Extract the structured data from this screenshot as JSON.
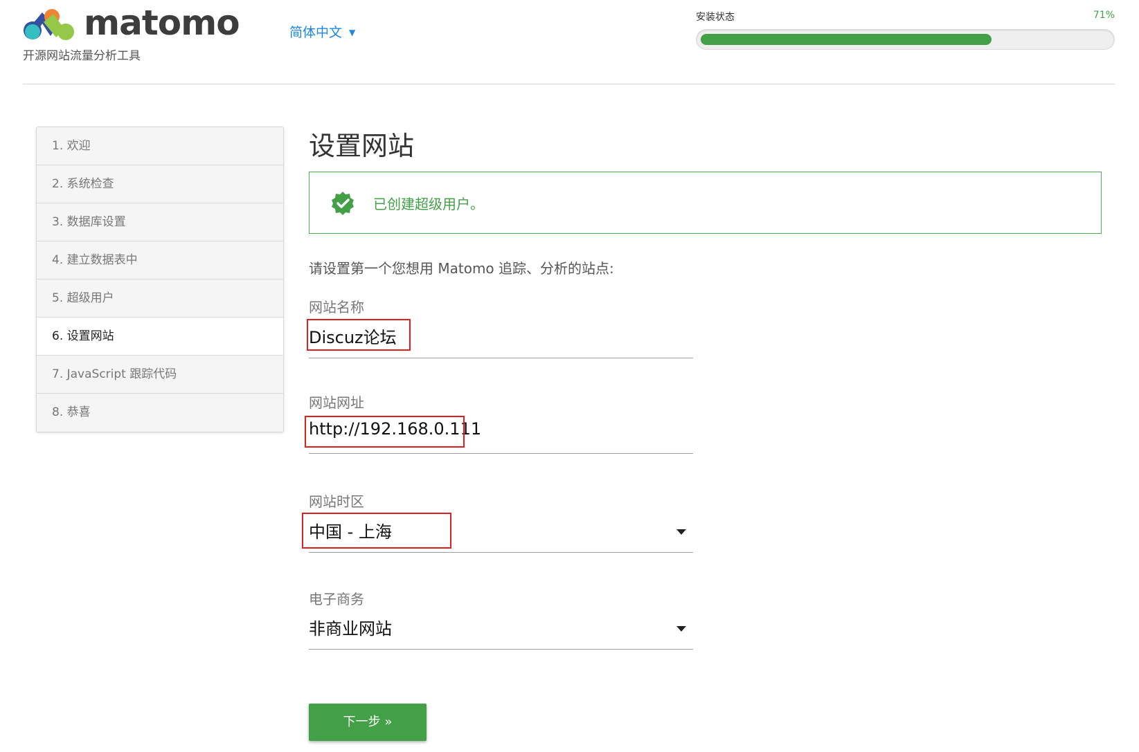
{
  "header": {
    "brand": "matomo",
    "tagline": "开源网站流量分析工具",
    "language": "简体中文",
    "progress_label": "安装状态",
    "progress_percent_text": "71%",
    "progress_value": 0.71
  },
  "steps": [
    {
      "label": "1. 欢迎"
    },
    {
      "label": "2. 系统检查"
    },
    {
      "label": "3. 数据库设置"
    },
    {
      "label": "4. 建立数据表中"
    },
    {
      "label": "5. 超级用户"
    },
    {
      "label": "6. 设置网站"
    },
    {
      "label": "7. JavaScript 跟踪代码"
    },
    {
      "label": "8. 恭喜"
    }
  ],
  "main": {
    "title": "设置网站",
    "notice": "已创建超级用户。",
    "intro": "请设置第一个您想用 Matomo 追踪、分析的站点:",
    "site_name_label": "网站名称",
    "site_name_value": "Discuz论坛",
    "site_url_label": "网站网址",
    "site_url_value": "http://192.168.0.111",
    "timezone_label": "网站时区",
    "timezone_value": "中国 - 上海",
    "ecommerce_label": "电子商务",
    "ecommerce_value": "非商业网站",
    "next_button": "下一步 »"
  },
  "colors": {
    "accent_green": "#43a047",
    "link_blue": "#1e88e5",
    "highlight_red": "#e02020"
  }
}
